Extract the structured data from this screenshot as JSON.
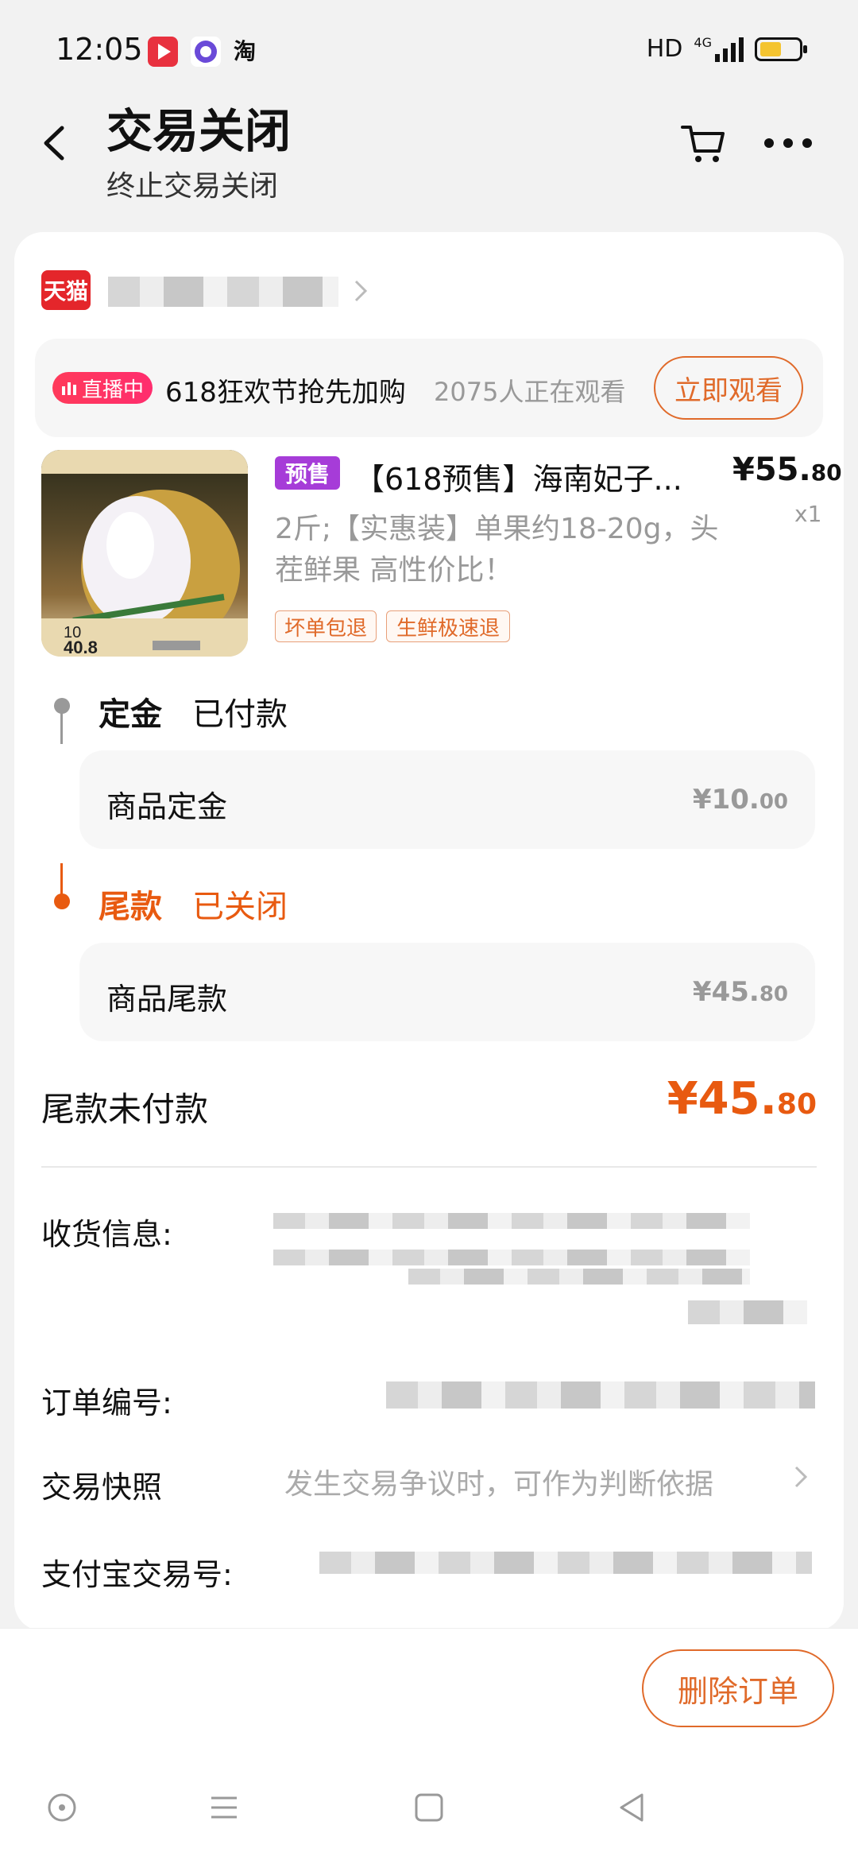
{
  "status_bar": {
    "time": "12:05",
    "network": "HD",
    "signal_label": "4G",
    "battery_level": 0.45
  },
  "header": {
    "title": "交易关闭",
    "subtitle": "终止交易关闭"
  },
  "shop": {
    "platform_logo": "天猫"
  },
  "live": {
    "badge": "直播中",
    "title": "618狂欢节抢先加购",
    "viewers": "2075人正在观看",
    "watch_button": "立即观看"
  },
  "product": {
    "presale_tag": "预售",
    "title": "【618预售】海南妃子...",
    "price_int": "¥55.",
    "price_dec": "80",
    "quantity": "x1",
    "spec": "2斤;【实惠装】单果约18-20g，头茬鲜果 高性价比！",
    "image_text_1": "10",
    "image_text_2": "40.8",
    "tags": [
      "坏单包退",
      "生鲜极速退"
    ]
  },
  "deposit_stage": {
    "label": "定金",
    "status": "已付款",
    "item_label": "商品定金",
    "amount_int": "¥10.",
    "amount_dec": "00"
  },
  "final_stage": {
    "label": "尾款",
    "status": "已关闭",
    "item_label": "商品尾款",
    "amount_int": "¥45.",
    "amount_dec": "80"
  },
  "unpaid": {
    "label": "尾款未付款",
    "amount_int": "¥45.",
    "amount_dec": "80"
  },
  "info": {
    "shipping_label": "收货信息:",
    "order_no_label": "订单编号:",
    "snapshot_label": "交易快照",
    "snapshot_hint": "发生交易争议时，可作为判断依据",
    "alipay_label": "支付宝交易号:"
  },
  "actions": {
    "delete_order": "删除订单"
  },
  "colors": {
    "accent": "#e06a2a",
    "price_red": "#e85a10",
    "presale_purple": "#a63cd8",
    "tmall_red": "#e4262b"
  }
}
